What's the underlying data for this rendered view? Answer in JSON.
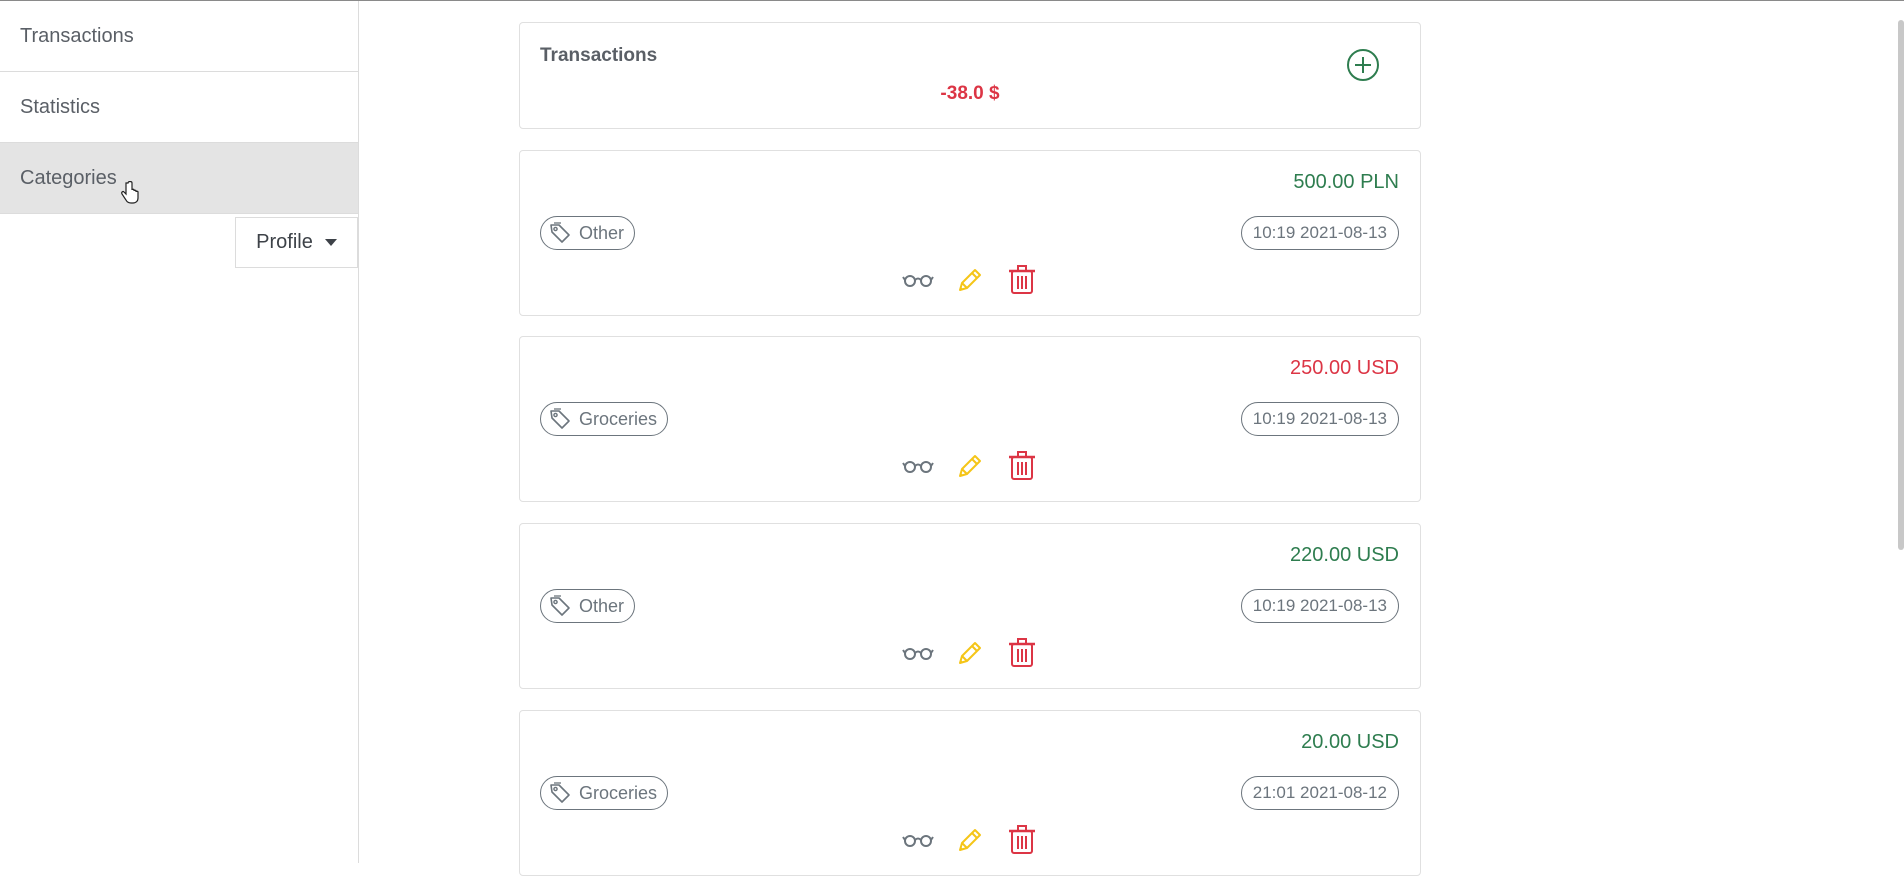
{
  "sidebar": {
    "items": [
      {
        "label": "Transactions"
      },
      {
        "label": "Statistics"
      },
      {
        "label": "Categories"
      }
    ],
    "profile_label": "Profile"
  },
  "header": {
    "title": "Transactions",
    "total": "-38.0 $"
  },
  "transactions": [
    {
      "amount": "500.00 PLN",
      "sign": "positive",
      "category": "Other",
      "datetime": "10:19 2021-08-13"
    },
    {
      "amount": "250.00 USD",
      "sign": "negative",
      "category": "Groceries",
      "datetime": "10:19 2021-08-13"
    },
    {
      "amount": "220.00 USD",
      "sign": "positive",
      "category": "Other",
      "datetime": "10:19 2021-08-13"
    },
    {
      "amount": "20.00 USD",
      "sign": "positive",
      "category": "Groceries",
      "datetime": "21:01 2021-08-12"
    }
  ],
  "colors": {
    "positive": "#2e7d4f",
    "negative": "#dc3545",
    "edit": "#f5c518",
    "delete": "#dc3545",
    "view": "#6c757d"
  },
  "icons": {
    "add": "plus-circle-icon",
    "category": "tag-icon",
    "view": "eyeglasses-icon",
    "edit": "pencil-icon",
    "delete": "trash-icon"
  }
}
